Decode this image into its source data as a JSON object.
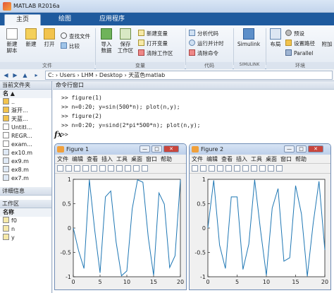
{
  "window": {
    "title": "MATLAB R2016a"
  },
  "tabs": [
    "主页",
    "绘图",
    "应用程序"
  ],
  "ribbon": {
    "new_script": "新建\n脚本",
    "new": "新建",
    "open": "打开",
    "find_files": "查找文件",
    "compare": "比较",
    "import_data": "导入\n数据",
    "save_workspace": "保存\n工作区",
    "new_variable": "新建变量",
    "open_variable": "打开变量",
    "clear_workspace": "清除工作区",
    "analyze_code": "分析代码",
    "run_and_time": "运行并计时",
    "clear_commands": "清除命令",
    "simulink": "Simulink",
    "layout": "布局",
    "preferences": "预设",
    "set_path": "设置路径",
    "parallel": "Parallel",
    "add_ons": "附加",
    "groups": {
      "file": "文件",
      "variable": "变量",
      "code": "代码",
      "simulink": "SIMULINK",
      "environment": "环境"
    }
  },
  "address": {
    "path": "C:  ›  Users  ›  LHM  ›  Desktop  ›  天蓝色matlab"
  },
  "current_folder": {
    "title": "当前文件夹",
    "col": "名",
    "items": [
      "..",
      "渐开...",
      "天蓝...",
      "Untitl...",
      "REGR...",
      "exam...",
      "ex10.m",
      "ex9.m",
      "ex8.m",
      "ex7.m"
    ]
  },
  "details": {
    "title": "详细信息"
  },
  "workspace": {
    "title": "工作区",
    "col": "名称",
    "vars": [
      "f0",
      "n",
      "y"
    ]
  },
  "command_window": {
    "title": "命令行窗口",
    "lines": [
      ">> figure(1)",
      ">> n=0:20; y=sin(500*n); plot(n,y);",
      ">> figure(2)",
      ">> n=0:20; y=sind(2*pi*500*n); plot(n,y);",
      ">>"
    ],
    "prompt_symbol": "fx"
  },
  "figures": [
    {
      "title": "Figure 1"
    },
    {
      "title": "Figure 2"
    }
  ],
  "figure_menu": [
    "文件",
    "编辑",
    "查看",
    "插入",
    "工具",
    "桌面",
    "窗口",
    "帮助"
  ],
  "window_buttons": {
    "min": "—",
    "max": "□",
    "close": "✕"
  },
  "chart_data": [
    {
      "type": "line",
      "x": [
        0,
        1,
        2,
        3,
        4,
        5,
        6,
        7,
        8,
        9,
        10,
        11,
        12,
        13,
        14,
        15,
        16,
        17,
        18,
        19,
        20
      ],
      "series": [
        {
          "values": [
            0,
            -0.47,
            -0.83,
            0.99,
            -0.04,
            -0.92,
            0.64,
            0.76,
            -0.29,
            -0.98,
            -0.88,
            0.39,
            0.99,
            0.94,
            -0.19,
            -0.97,
            0.72,
            0.49,
            -0.81,
            -0.57,
            0.99
          ]
        }
      ],
      "xlim": [
        0,
        20
      ],
      "ylim": [
        -1,
        1
      ],
      "xticks": [
        0,
        5,
        10,
        15,
        20
      ],
      "yticks": [
        -1,
        -0.5,
        0,
        0.5,
        1
      ],
      "line_color": "#1f77b4"
    },
    {
      "type": "line",
      "x": [
        0,
        1,
        2,
        3,
        4,
        5,
        6,
        7,
        8,
        9,
        10,
        11,
        12,
        13,
        14,
        15,
        16,
        17,
        18,
        19,
        20
      ],
      "series": [
        {
          "values": [
            0,
            0.98,
            -0.35,
            -0.83,
            0.64,
            0.64,
            -0.85,
            -0.33,
            0.99,
            -0.04,
            -0.97,
            0.41,
            0.81,
            -0.68,
            -0.61,
            0.87,
            0.29,
            -0.99,
            0.09,
            0.96,
            -0.45
          ]
        }
      ],
      "xlim": [
        0,
        20
      ],
      "ylim": [
        -1,
        1
      ],
      "xticks": [
        0,
        5,
        10,
        15,
        20
      ],
      "yticks": [
        -1,
        -0.5,
        0,
        0.5,
        1
      ],
      "line_color": "#1f77b4"
    }
  ]
}
